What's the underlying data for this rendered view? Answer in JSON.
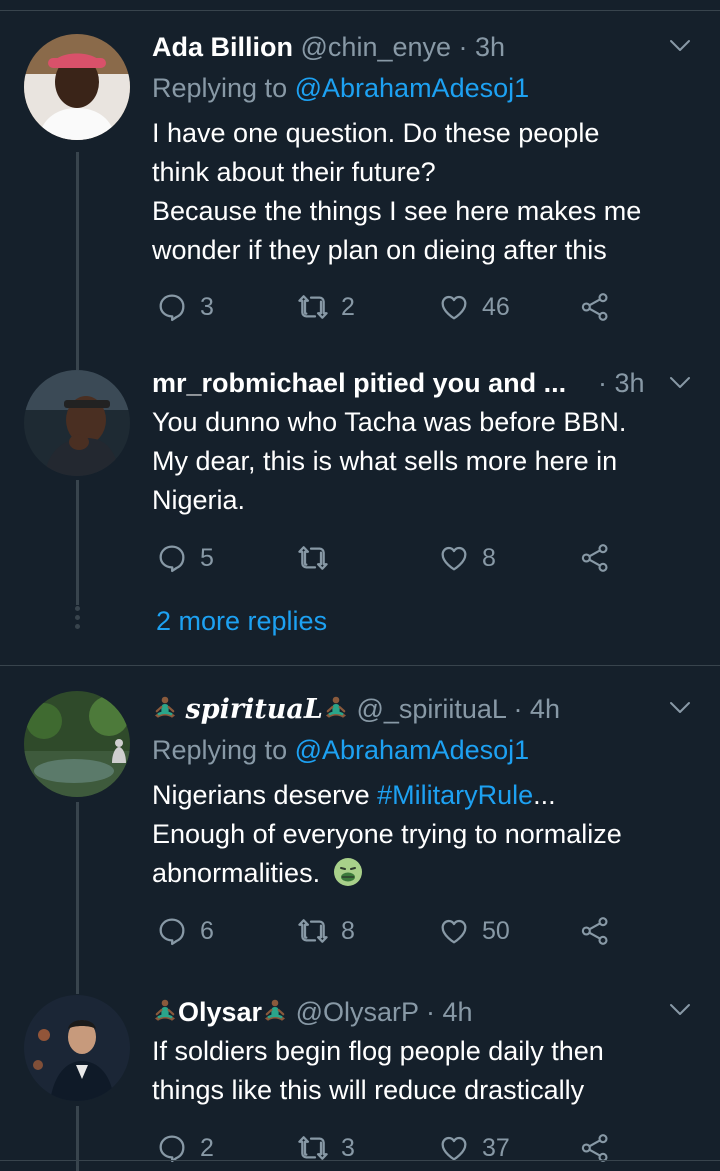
{
  "tweets": [
    {
      "name": "Ada Billion",
      "handle": "@chin_enye",
      "time": "· 3h",
      "replying_prefix": "Replying to ",
      "replying_to": "@AbrahamAdesoj1",
      "body": [
        "I have one question. Do these people",
        "think about their future?",
        "Because the things I see here makes me",
        "wonder if they plan on dieing after this"
      ],
      "replies": "3",
      "retweets": "2",
      "likes": "46"
    },
    {
      "name": "mr_robmichael pitied you and ...",
      "time": "· 3h",
      "body": [
        "You dunno who Tacha was before BBN.",
        "My dear, this is what sells more here in",
        "Nigeria."
      ],
      "replies": "5",
      "retweets": "",
      "likes": "8"
    },
    {
      "name": "spirituaL",
      "handle": "@_spiriituaL",
      "time": "· 4h",
      "replying_prefix": "Replying to ",
      "replying_to": "@AbrahamAdesoj1",
      "body_pre": "Nigerians deserve ",
      "body_tag": "#MilitaryRule",
      "body_post": "...",
      "body": [
        "Enough of everyone trying to normalize",
        "abnormalities."
      ],
      "replies": "6",
      "retweets": "8",
      "likes": "50"
    },
    {
      "name": "Olysar",
      "handle": "@OlysarP",
      "time": "· 4h",
      "body": [
        "If soldiers begin flog people daily then",
        "things like this will reduce drastically"
      ],
      "replies": "2",
      "retweets": "3",
      "likes": "37"
    }
  ],
  "more_replies": "2 more replies",
  "colors": {
    "background": "#15202b",
    "muted": "#8899a6",
    "link": "#1da1f2",
    "divider": "#38444d"
  }
}
